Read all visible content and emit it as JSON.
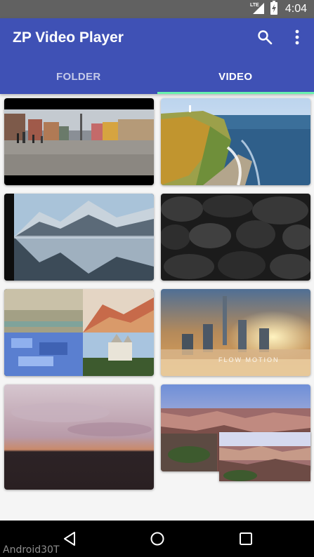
{
  "status_bar": {
    "network_label": "LTE",
    "time": "4:04",
    "icons": [
      "signal-icon",
      "battery-icon"
    ]
  },
  "app_bar": {
    "title": "ZP Video Player",
    "actions": [
      "search-icon",
      "more-vert-icon"
    ],
    "background_color": "#3f51b5",
    "indicator_color": "#69f0ae"
  },
  "tabs": [
    {
      "label": "FOLDER",
      "selected": false
    },
    {
      "label": "VIDEO",
      "selected": true
    }
  ],
  "videos": [
    {
      "name": "street-plaza-video",
      "caption": ""
    },
    {
      "name": "coastal-cliff-video",
      "caption": ""
    },
    {
      "name": "snowy-mountain-reflection-video",
      "caption": ""
    },
    {
      "name": "dark-stone-wall-video",
      "caption": ""
    },
    {
      "name": "landscape-collage-video",
      "caption": ""
    },
    {
      "name": "flow-motion-city-video",
      "caption": "FLOW MOTION"
    },
    {
      "name": "sunset-sky-video",
      "caption": ""
    },
    {
      "name": "canyon-view-video",
      "caption": ""
    }
  ],
  "nav_bar": {
    "buttons": [
      "back-icon",
      "home-icon",
      "recents-icon"
    ]
  },
  "watermark": "Android30T"
}
